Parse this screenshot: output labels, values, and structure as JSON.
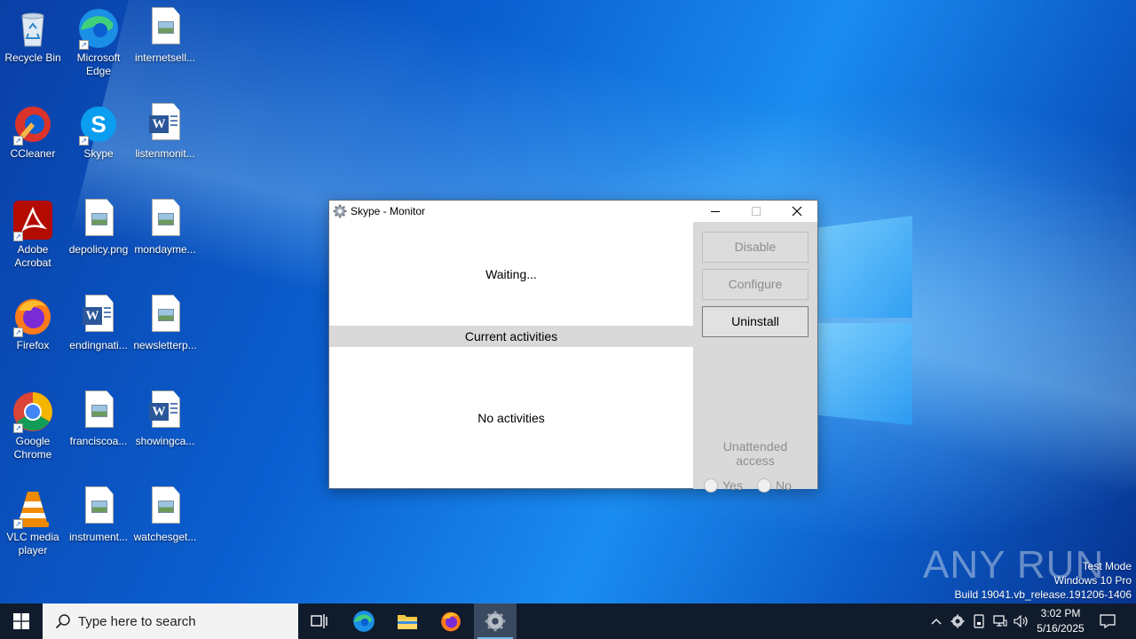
{
  "desktop": {
    "icons": [
      {
        "label": "Recycle Bin",
        "icon": "recycle-bin-icon"
      },
      {
        "label": "Microsoft Edge",
        "icon": "edge-icon"
      },
      {
        "label": "internetsell...",
        "icon": "image-file-icon"
      },
      {
        "label": "CCleaner",
        "icon": "ccleaner-icon"
      },
      {
        "label": "Skype",
        "icon": "skype-icon"
      },
      {
        "label": "listenmonit...",
        "icon": "word-file-icon"
      },
      {
        "label": "Adobe Acrobat",
        "icon": "acrobat-icon"
      },
      {
        "label": "depolicy.png",
        "icon": "image-file-icon"
      },
      {
        "label": "mondayme...",
        "icon": "image-file-icon"
      },
      {
        "label": "Firefox",
        "icon": "firefox-icon"
      },
      {
        "label": "endingnati...",
        "icon": "word-file-icon"
      },
      {
        "label": "newsletterp...",
        "icon": "image-file-icon"
      },
      {
        "label": "Google Chrome",
        "icon": "chrome-icon"
      },
      {
        "label": "franciscoa...",
        "icon": "image-file-icon"
      },
      {
        "label": "showingca...",
        "icon": "word-file-icon"
      },
      {
        "label": "VLC media player",
        "icon": "vlc-icon"
      },
      {
        "label": "instrument...",
        "icon": "image-file-icon"
      },
      {
        "label": "watchesget...",
        "icon": "image-file-icon"
      }
    ]
  },
  "window": {
    "title": "Skype - Monitor",
    "status": "Waiting...",
    "activities_header": "Current activities",
    "activities_empty": "No activities",
    "buttons": {
      "disable": "Disable",
      "configure": "Configure",
      "uninstall": "Uninstall"
    },
    "unattended_label": "Unattended access",
    "radio_yes": "Yes",
    "radio_no": "No"
  },
  "watermark": {
    "brand": "ANY RUN",
    "mode": "Test Mode",
    "edition": "Windows 10 Pro",
    "build": "Build 19041.vb_release.191206-1406"
  },
  "taskbar": {
    "search_placeholder": "Type here to search",
    "time": "3:02 PM",
    "date": "5/16/2025"
  },
  "colors": {
    "taskbar_bg": "#101b2c",
    "desktop_accent": "#0b5fd0",
    "window_panel": "#d9d9d9"
  }
}
